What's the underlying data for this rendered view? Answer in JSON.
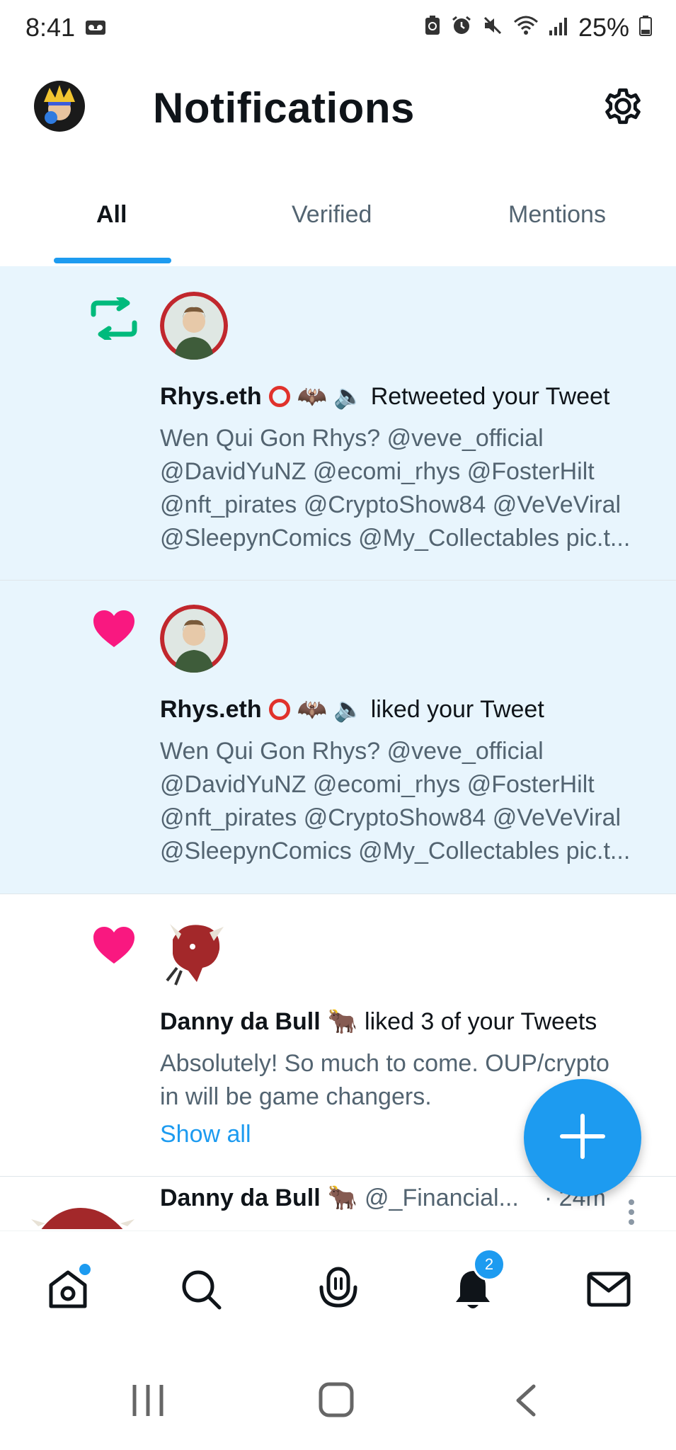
{
  "status_bar": {
    "time": "8:41",
    "battery": "25%"
  },
  "header": {
    "title": "Notifications"
  },
  "tabs": [
    {
      "label": "All",
      "active": true
    },
    {
      "label": "Verified",
      "active": false
    },
    {
      "label": "Mentions",
      "active": false
    }
  ],
  "notifications": [
    {
      "type": "retweet",
      "name": "Rhys.eth",
      "emojis": "🦇 🔈",
      "action": "Retweeted your Tweet",
      "lines": [
        "Wen Qui Gon Rhys? @veve_official",
        "@DavidYuNZ @ecomi_rhys @FosterHilt",
        "@nft_pirates @CryptoShow84 @VeVeViral",
        "@SleepynComics @My_Collectables pic.t..."
      ]
    },
    {
      "type": "like",
      "name": "Rhys.eth",
      "emojis": "🦇 🔈",
      "action": "liked your Tweet",
      "lines": [
        "Wen Qui Gon Rhys? @veve_official",
        "@DavidYuNZ @ecomi_rhys @FosterHilt",
        "@nft_pirates @CryptoShow84 @VeVeViral",
        "@SleepynComics @My_Collectables pic.t..."
      ]
    },
    {
      "type": "like",
      "name": "Danny da Bull",
      "emojis": "🐂",
      "action": "liked 3 of your Tweets",
      "lines": [
        "Absolutely! So much to come. OUP/crypto",
        "in will be game changers."
      ],
      "show_all": "Show all"
    }
  ],
  "tweet_row": {
    "name": "Danny da Bull",
    "emoji": "🐂",
    "handle": "@_Financial...",
    "time": "· 24m"
  },
  "bottom_nav": {
    "notification_count": "2"
  },
  "colors": {
    "accent": "#1d9bf0",
    "retweet": "#00ba7c",
    "like": "#f91880",
    "unread_bg": "#e8f5fd"
  }
}
